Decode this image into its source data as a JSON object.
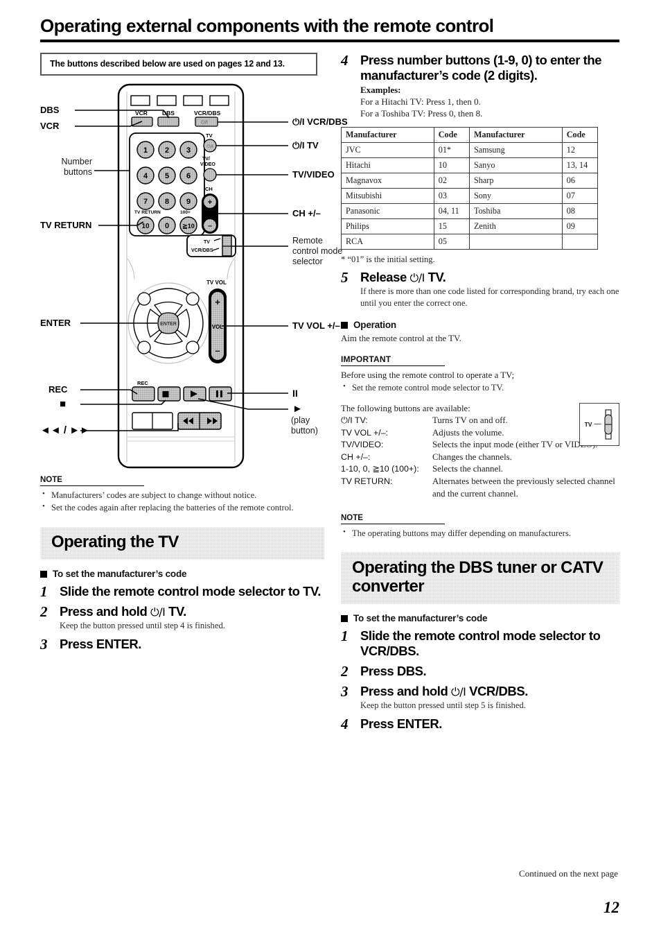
{
  "page": {
    "title": "Operating external components with the remote control",
    "page_number": "12",
    "continued": "Continued on the next page"
  },
  "callout": {
    "text": "The buttons described below are used on pages 12 and 13."
  },
  "diagram": {
    "name": "remote-control-diagram",
    "left_labels": [
      {
        "key": "dbs",
        "text": "DBS"
      },
      {
        "key": "vcr",
        "text": "VCR"
      },
      {
        "key": "number_buttons",
        "text": "Number\nbuttons"
      },
      {
        "key": "tv_return",
        "text": "TV RETURN"
      },
      {
        "key": "enter",
        "text": "ENTER"
      },
      {
        "key": "rec",
        "text": "REC"
      },
      {
        "key": "stop",
        "text": "■"
      },
      {
        "key": "rew_ff",
        "text": "◄◄ / ►►"
      }
    ],
    "right_labels": [
      {
        "key": "power_vcr_dbs",
        "text": "⏻/I VCR/DBS"
      },
      {
        "key": "power_tv",
        "text": "⏻/I TV"
      },
      {
        "key": "tv_video",
        "text": "TV/VIDEO"
      },
      {
        "key": "ch",
        "text": "CH +/–"
      },
      {
        "key": "mode_selector",
        "text": "Remote\ncontrol mode\nselector"
      },
      {
        "key": "tv_vol",
        "text": "TV VOL +/–"
      },
      {
        "key": "pause",
        "text": "II"
      },
      {
        "key": "play",
        "text": "►"
      },
      {
        "key": "play_note",
        "text": "(play button)"
      }
    ],
    "keypad": [
      "1",
      "2",
      "3",
      "4",
      "5",
      "6",
      "7",
      "8",
      "9",
      "10",
      "0",
      "≧ 10"
    ],
    "keycap_labels": {
      "vcr": "VCR",
      "dbs": "DBS",
      "vcr_dbs": "VCR/DBS",
      "tv": "TV",
      "tv_video": "TV/\nVIDEO",
      "ch": "CH",
      "tv_vol": "TV VOL",
      "vol": "VOL",
      "enter": "ENTER",
      "rec": "REC",
      "tv_return": "TV RETURN",
      "hundred_plus": "100+",
      "selector_tv": "TV",
      "selector_vcrdbs": "VCR/DBS",
      "power_glyph": "⏻/I"
    }
  },
  "left_note": {
    "heading": "NOTE",
    "items": [
      "Manufacturers’ codes are subject to change without notice.",
      "Set the codes again after replacing the batteries of the remote control."
    ]
  },
  "tv_section": {
    "banner": "Operating the TV",
    "subhead": "To set the manufacturer’s code",
    "steps": [
      {
        "num": "1",
        "title": "Slide the remote control mode selector to TV.",
        "sub": ""
      },
      {
        "num": "2",
        "title_pre": "Press and hold ",
        "power": "⏻/I",
        "title_post": " TV.",
        "sub": "Keep the button pressed until step 4 is finished."
      },
      {
        "num": "3",
        "title": "Press ENTER.",
        "sub": ""
      }
    ]
  },
  "step4": {
    "num": "4",
    "title": "Press number buttons (1-9, 0) to enter the manufacturer’s code (2 digits).",
    "examples_label": "Examples:",
    "examples": [
      "For a Hitachi TV: Press 1, then 0.",
      "For a Toshiba TV: Press 0, then 8."
    ]
  },
  "code_table": {
    "headers": [
      "Manufacturer",
      "Code",
      "Manufacturer",
      "Code"
    ],
    "rows": [
      [
        "JVC",
        "01*",
        "Samsung",
        "12"
      ],
      [
        "Hitachi",
        "10",
        "Sanyo",
        "13, 14"
      ],
      [
        "Magnavox",
        "02",
        "Sharp",
        "06"
      ],
      [
        "Mitsubishi",
        "03",
        "Sony",
        "07"
      ],
      [
        "Panasonic",
        "04, 11",
        "Toshiba",
        "08"
      ],
      [
        "Philips",
        "15",
        "Zenith",
        "09"
      ],
      [
        "RCA",
        "05",
        "",
        ""
      ]
    ],
    "footnote": "* “01” is the initial setting."
  },
  "step5": {
    "num": "5",
    "title_pre": "Release ",
    "power": "⏻/I",
    "title_post": " TV.",
    "sub": "If there is more than one code listed for corresponding brand, try each one until you enter the correct one."
  },
  "operation": {
    "subhead": "Operation",
    "text": "Aim the remote control at the TV.",
    "important_head": "IMPORTANT",
    "important_line": "Before using the remote control to operate a TV;",
    "important_bullet": "Set the remote control mode selector to TV.",
    "available_intro": "The following buttons are available:",
    "fig_label": "TV",
    "buttons": [
      {
        "key": "⏻/I TV:",
        "value": "Turns TV on and off."
      },
      {
        "key": "TV VOL +/–:",
        "value": "Adjusts the volume."
      },
      {
        "key": "TV/VIDEO:",
        "value": "Selects the input mode (either TV or VIDEO)."
      },
      {
        "key": "CH +/–:",
        "value": "Changes the channels."
      },
      {
        "key": "1-10, 0, ≧10 (100+):",
        "value": "Selects the channel."
      },
      {
        "key": "TV RETURN:",
        "value": "Alternates between the previously selected channel and the current channel."
      }
    ]
  },
  "right_note": {
    "heading": "NOTE",
    "items": [
      "The operating buttons may differ depending on manufacturers."
    ]
  },
  "dbs_section": {
    "banner": "Operating the DBS tuner or CATV converter",
    "subhead": "To set the manufacturer’s code",
    "steps": [
      {
        "num": "1",
        "title": "Slide the remote control mode selector to VCR/DBS.",
        "sub": ""
      },
      {
        "num": "2",
        "title": "Press DBS.",
        "sub": ""
      },
      {
        "num": "3",
        "title_pre": "Press and hold ",
        "power": "⏻/I",
        "title_post": " VCR/DBS.",
        "sub": "Keep the button pressed until step 5 is finished."
      },
      {
        "num": "4",
        "title": "Press ENTER.",
        "sub": ""
      }
    ]
  },
  "colors": {
    "banner_gray": "#cfcfcf",
    "key_gray": "#b9b9b9",
    "ink": "#000000"
  }
}
